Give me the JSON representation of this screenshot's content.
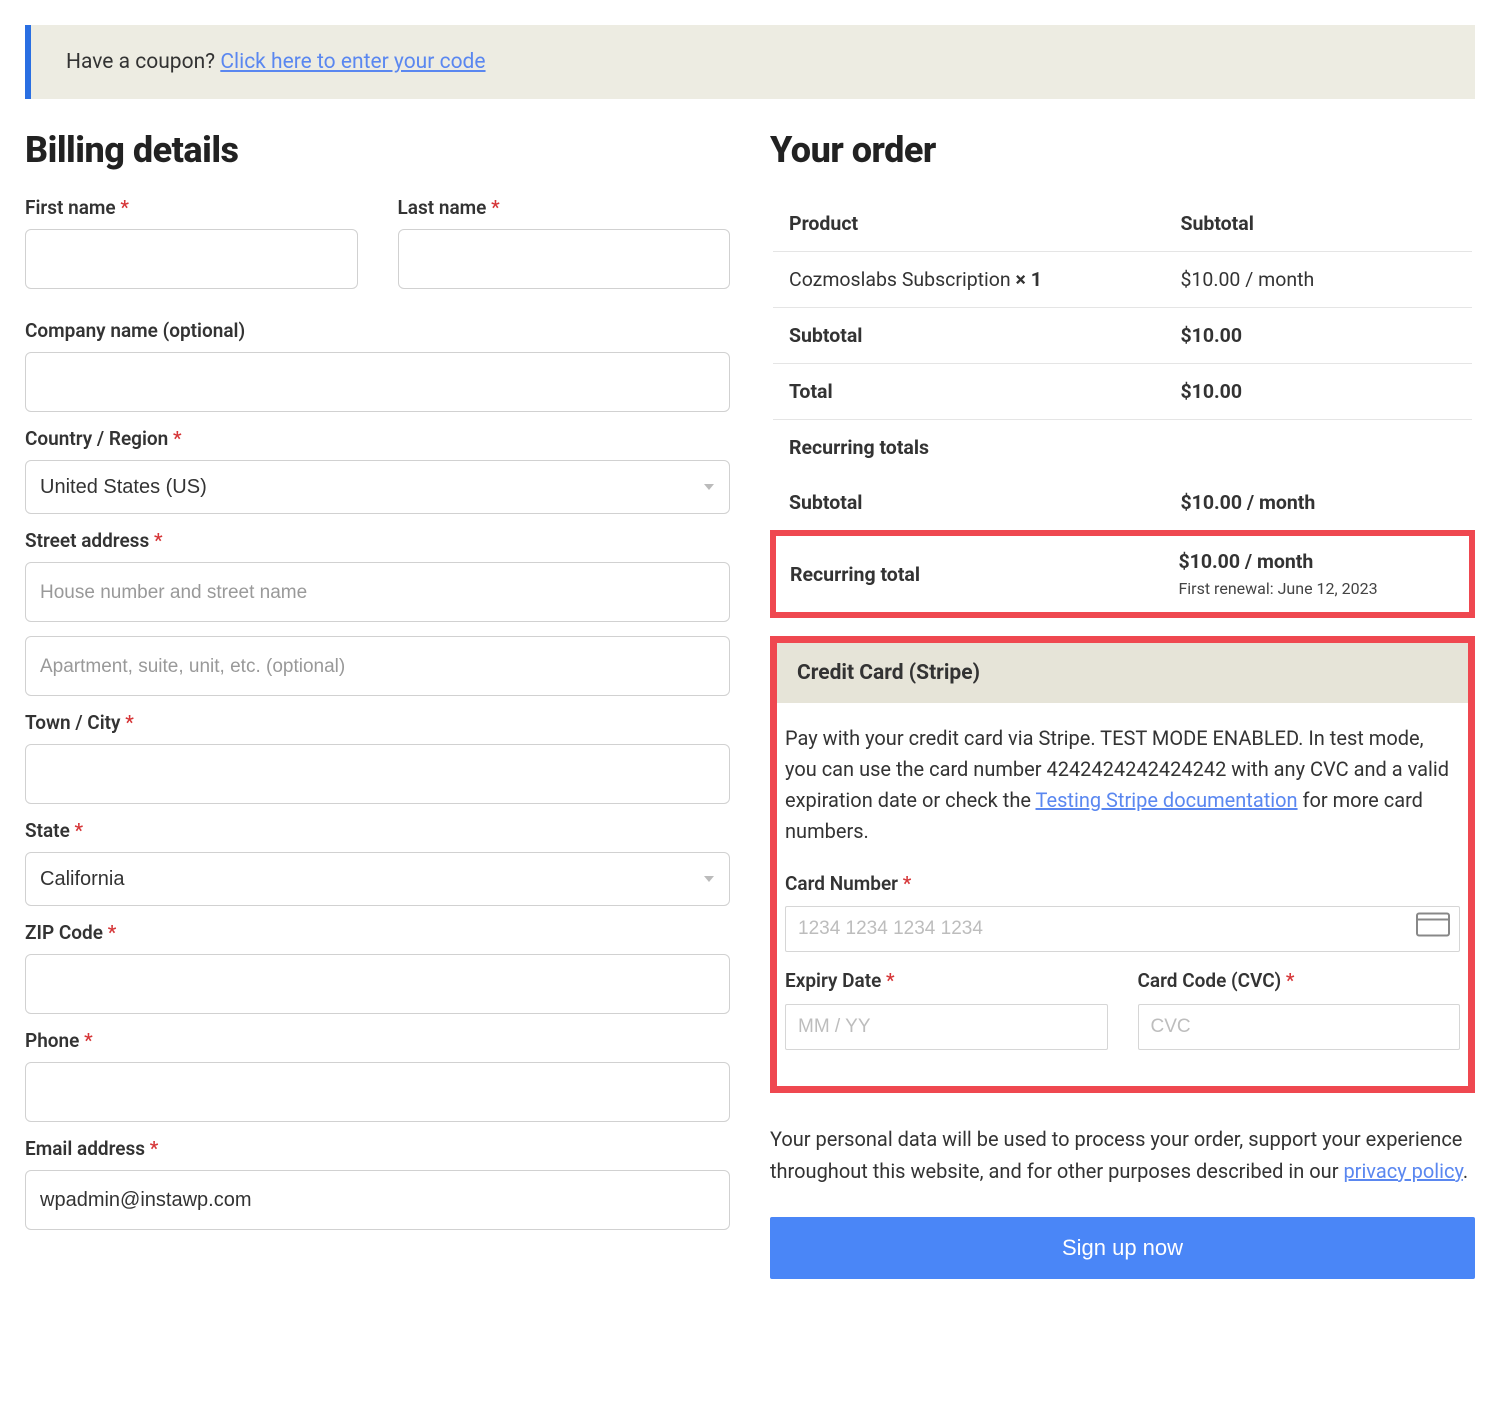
{
  "coupon": {
    "prompt": "Have a coupon? ",
    "link": "Click here to enter your code"
  },
  "billing": {
    "heading": "Billing details",
    "first_name_label": "First name",
    "last_name_label": "Last name",
    "company_label": "Company name (optional)",
    "country_label": "Country / Region",
    "country_value": "United States (US)",
    "street_label": "Street address",
    "street_placeholder1": "House number and street name",
    "street_placeholder2": "Apartment, suite, unit, etc. (optional)",
    "city_label": "Town / City",
    "state_label": "State",
    "state_value": "California",
    "zip_label": "ZIP Code",
    "phone_label": "Phone",
    "email_label": "Email address",
    "email_value": "wpadmin@instawp.com"
  },
  "order": {
    "heading": "Your order",
    "product_header": "Product",
    "subtotal_header": "Subtotal",
    "product_name": "Cozmoslabs Subscription ",
    "product_qty": " × 1",
    "product_price": "$10.00 / month",
    "subtotal_label": "Subtotal",
    "subtotal_value": "$10.00",
    "total_label": "Total",
    "total_value": "$10.00",
    "recurring_totals_label": "Recurring totals",
    "recurring_subtotal_label": "Subtotal",
    "recurring_subtotal_value": "$10.00 / month",
    "recurring_total_label": "Recurring total",
    "recurring_total_value": "$10.00 / month",
    "first_renewal": "First renewal: June 12, 2023"
  },
  "payment": {
    "header": "Credit Card (Stripe)",
    "desc_pre": "Pay with your credit card via Stripe. TEST MODE ENABLED. In test mode, you can use the card number 4242424242424242 with any CVC and a valid expiration date or check the ",
    "desc_link": "Testing Stripe documentation",
    "desc_post": " for more card numbers.",
    "card_number_label": "Card Number",
    "card_number_placeholder": "1234 1234 1234 1234",
    "expiry_label": "Expiry Date",
    "expiry_placeholder": "MM / YY",
    "cvc_label": "Card Code (CVC)",
    "cvc_placeholder": "CVC"
  },
  "privacy": {
    "text_pre": "Your personal data will be used to process your order, support your experience throughout this website, and for other purposes described in our ",
    "link": "privacy policy",
    "text_post": "."
  },
  "signup_label": "Sign up now"
}
